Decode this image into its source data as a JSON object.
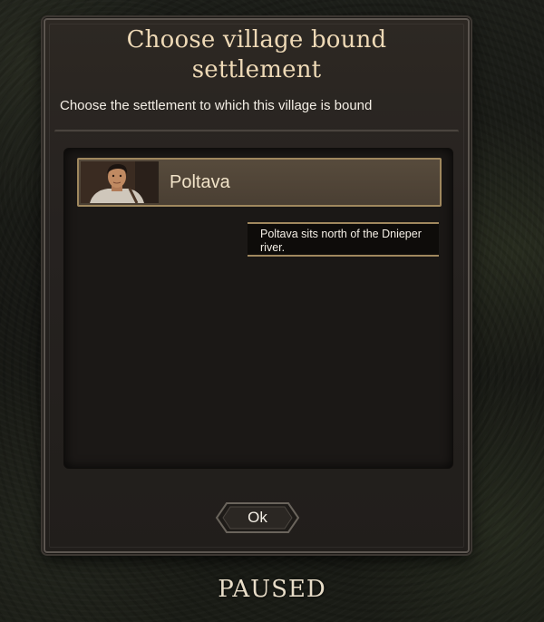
{
  "dialog": {
    "title": "Choose village bound settlement",
    "subtitle": "Choose the settlement to which this village is bound",
    "options": [
      {
        "label": "Poltava",
        "icon": "portrait-icon",
        "selected": true
      }
    ],
    "tooltip": "Poltava sits north of the Dnieper river.",
    "ok_label": "Ok"
  },
  "status": {
    "paused_label": "PAUSED"
  },
  "colors": {
    "title": "#eed9b6",
    "accent_gold": "#a0885e",
    "panel": "#262220"
  }
}
